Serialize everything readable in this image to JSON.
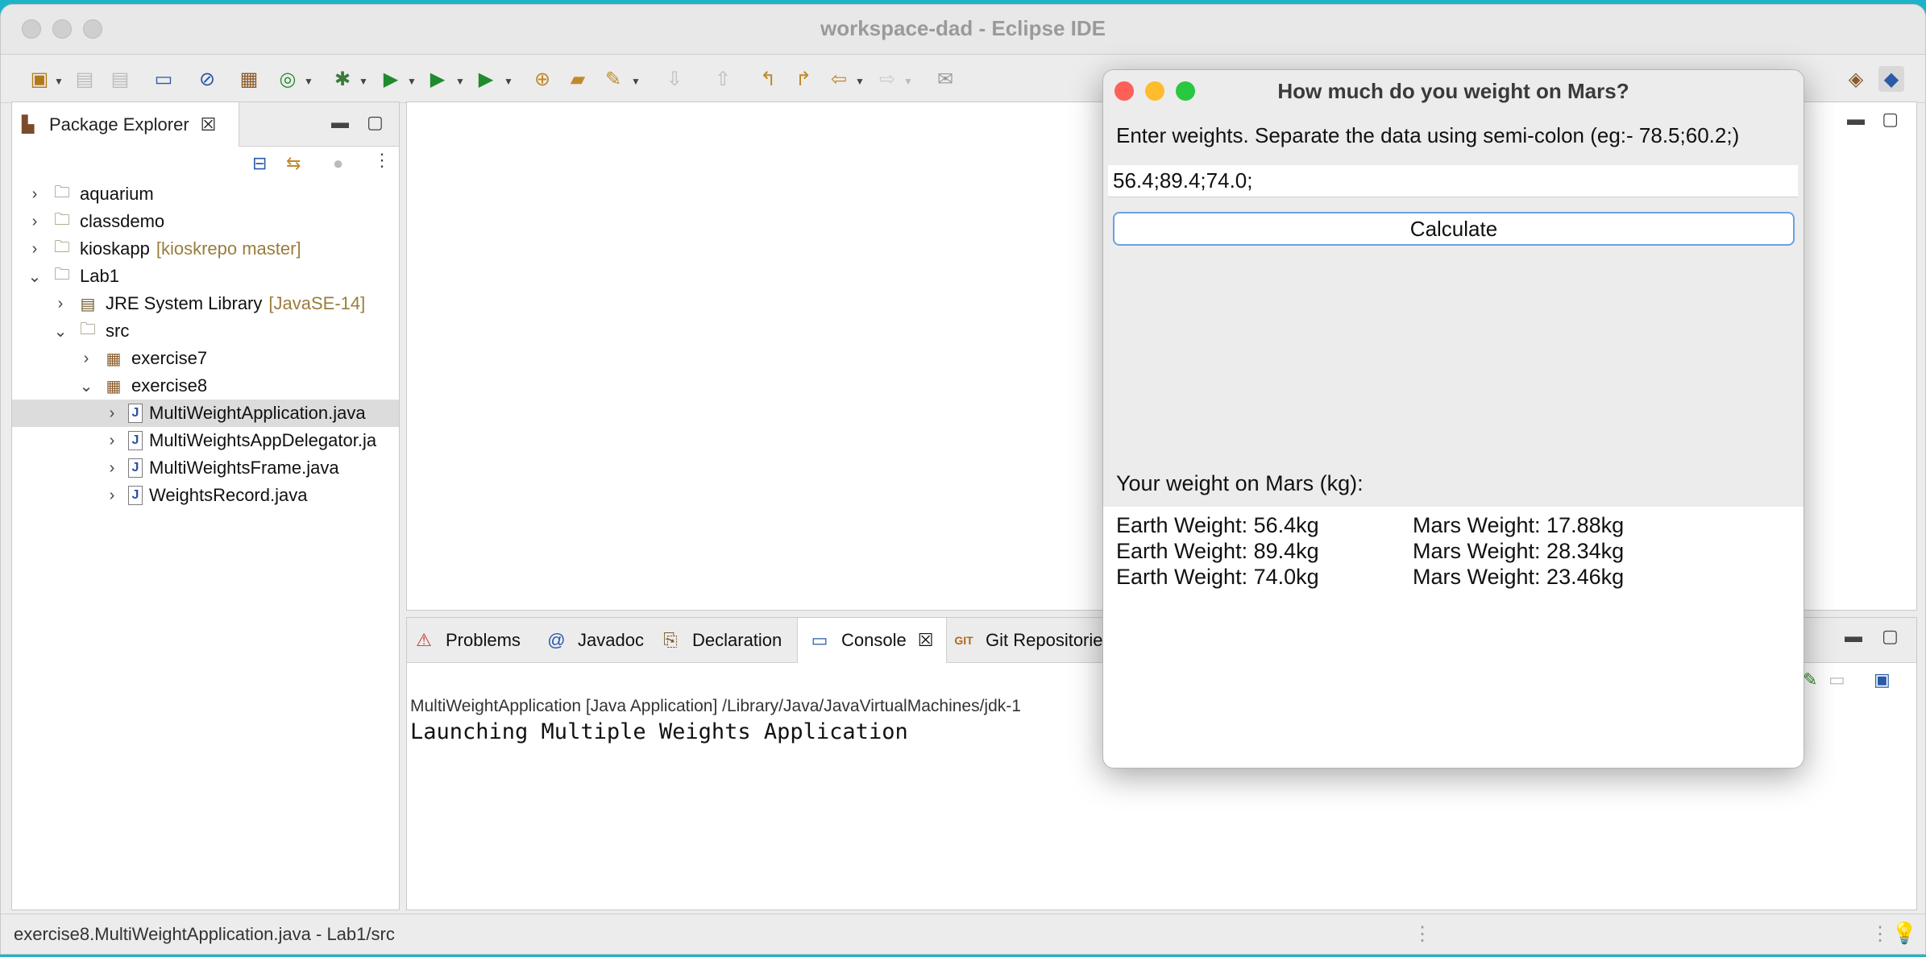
{
  "window": {
    "title": "workspace-dad - Eclipse IDE"
  },
  "package_explorer": {
    "tab_label": "Package Explorer",
    "items": [
      {
        "label": "aquarium",
        "decoration": "",
        "depth": 0,
        "expanded": false,
        "icon": "project-icon"
      },
      {
        "label": "classdemo",
        "decoration": "",
        "depth": 0,
        "expanded": false,
        "icon": "project-icon"
      },
      {
        "label": "kioskapp",
        "decoration": "[kioskrepo master]",
        "depth": 0,
        "expanded": false,
        "icon": "project-icon"
      },
      {
        "label": "Lab1",
        "decoration": "",
        "depth": 0,
        "expanded": true,
        "icon": "project-icon"
      },
      {
        "label": "JRE System Library",
        "decoration": "[JavaSE-14]",
        "depth": 1,
        "expanded": false,
        "icon": "library-icon"
      },
      {
        "label": "src",
        "decoration": "",
        "depth": 1,
        "expanded": true,
        "icon": "source-folder-icon"
      },
      {
        "label": "exercise7",
        "decoration": "",
        "depth": 2,
        "expanded": false,
        "icon": "package-icon"
      },
      {
        "label": "exercise8",
        "decoration": "",
        "depth": 2,
        "expanded": true,
        "icon": "package-icon"
      },
      {
        "label": "MultiWeightApplication.java",
        "decoration": "",
        "depth": 3,
        "expanded": false,
        "icon": "java-file-icon",
        "selected": true
      },
      {
        "label": "MultiWeightsAppDelegator.ja",
        "decoration": "",
        "depth": 3,
        "expanded": false,
        "icon": "java-file-icon"
      },
      {
        "label": "MultiWeightsFrame.java",
        "decoration": "",
        "depth": 3,
        "expanded": false,
        "icon": "java-file-icon"
      },
      {
        "label": "WeightsRecord.java",
        "decoration": "",
        "depth": 3,
        "expanded": false,
        "icon": "java-file-icon"
      }
    ]
  },
  "bottom_panel": {
    "tabs": [
      {
        "label": "Problems",
        "icon": "problems-icon"
      },
      {
        "label": "Javadoc",
        "icon": "at-icon"
      },
      {
        "label": "Declaration",
        "icon": "declaration-icon"
      },
      {
        "label": "Console",
        "icon": "console-icon",
        "active": true
      },
      {
        "label": "Git Repositorie",
        "icon": "git-icon"
      }
    ],
    "console_description": "MultiWeightApplication [Java Application] /Library/Java/JavaVirtualMachines/jdk-1",
    "console_output": "Launching Multiple Weights Application"
  },
  "status_bar": {
    "text": "exercise8.MultiWeightApplication.java - Lab1/src"
  },
  "dialog": {
    "title": "How much do you weight on Mars?",
    "instruction": "Enter weights. Separate the data using semi-colon (eg:- 78.5;60.2;)",
    "input_value": "56.4;89.4;74.0;",
    "calculate_label": "Calculate",
    "result_label": "Your weight on Mars (kg):",
    "results": [
      {
        "earth": "Earth Weight: 56.4kg",
        "mars": "Mars Weight: 17.88kg"
      },
      {
        "earth": "Earth Weight: 89.4kg",
        "mars": "Mars Weight: 28.34kg"
      },
      {
        "earth": "Earth Weight: 74.0kg",
        "mars": "Mars Weight: 23.46kg"
      }
    ],
    "traffic_colors": {
      "close": "#fe5f57",
      "minimize": "#febc2e",
      "zoom": "#28c840"
    }
  }
}
